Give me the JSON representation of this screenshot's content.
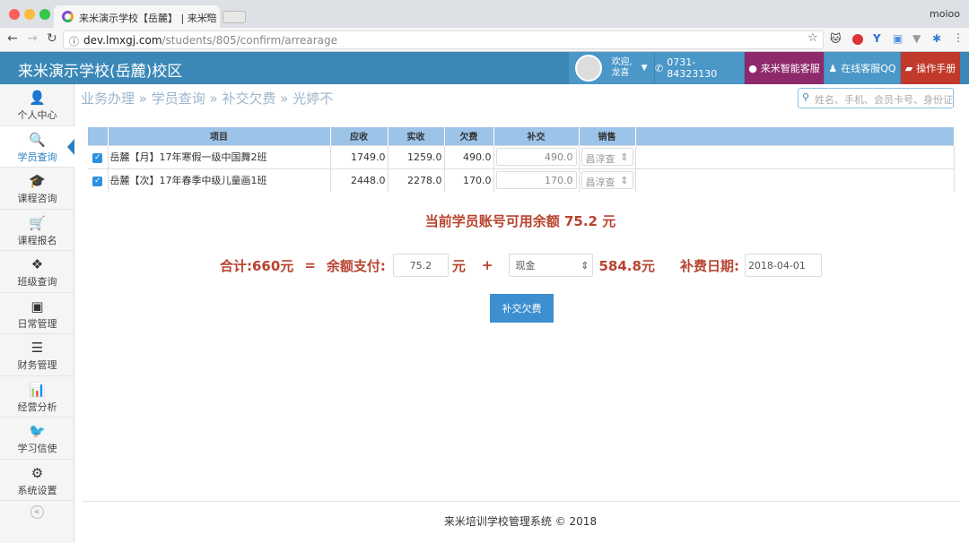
{
  "browser": {
    "tab_title": "来米演示学校【岳麓】 | 来米培",
    "user": "moioo",
    "url_host": "dev.lmxgj.com",
    "url_path": "/students/805/confirm/arrearage"
  },
  "header": {
    "brand": "来米演示学校(岳麓)校区",
    "welcome": "欢迎,",
    "username": "龙喜",
    "phone": "0731-84323130",
    "ai_service": "来米智能客服",
    "qq_service": "在线客服QQ",
    "manual": "操作手册",
    "colors": {
      "bar": "#3b88b7",
      "ai": "#8e2a6b",
      "manual": "#c0392b"
    }
  },
  "sidebar": {
    "items": [
      {
        "label": "个人中心",
        "icon": "user-icon"
      },
      {
        "label": "学员查询",
        "icon": "search-icon",
        "active": true
      },
      {
        "label": "课程咨询",
        "icon": "graduation-cap-icon"
      },
      {
        "label": "课程报名",
        "icon": "cart-icon"
      },
      {
        "label": "班级查询",
        "icon": "cubes-icon"
      },
      {
        "label": "日常管理",
        "icon": "board-icon"
      },
      {
        "label": "财务管理",
        "icon": "bars-icon"
      },
      {
        "label": "经营分析",
        "icon": "bar-chart-icon"
      },
      {
        "label": "学习信使",
        "icon": "twitter-icon"
      },
      {
        "label": "系统设置",
        "icon": "gears-icon"
      }
    ]
  },
  "breadcrumb": [
    "业务办理",
    "学员查询",
    "补交欠费",
    "光婷不"
  ],
  "search": {
    "placeholder": "姓名、手机、会员卡号、身份证"
  },
  "table": {
    "headers": [
      "项目",
      "应收",
      "实收",
      "欠费",
      "补交",
      "销售"
    ],
    "rows": [
      {
        "checked": true,
        "item": "岳麓【月】17年寒假一级中国舞2班",
        "due": "1749.0",
        "paid": "1259.0",
        "owed": "490.0",
        "pay": "490.0",
        "sales": "昌淳查"
      },
      {
        "checked": true,
        "item": "岳麓【次】17年春季中级儿童画1班",
        "due": "2448.0",
        "paid": "2278.0",
        "owed": "170.0",
        "pay": "170.0",
        "sales": "昌淳查"
      }
    ]
  },
  "balance_text": "当前学员账号可用余额 75.2 元",
  "summary": {
    "total_label": "合计:660元",
    "eq": "=",
    "balance_label": "余额支付:",
    "balance_value": "75.2",
    "yuan": "元",
    "plus": "+",
    "method": "现金",
    "remaining": "584.8元",
    "date_label": "补费日期:",
    "date": "2018-04-01"
  },
  "submit_label": "补交欠费",
  "footer": "来米培训学校管理系统 © 2018",
  "collapse": "«"
}
